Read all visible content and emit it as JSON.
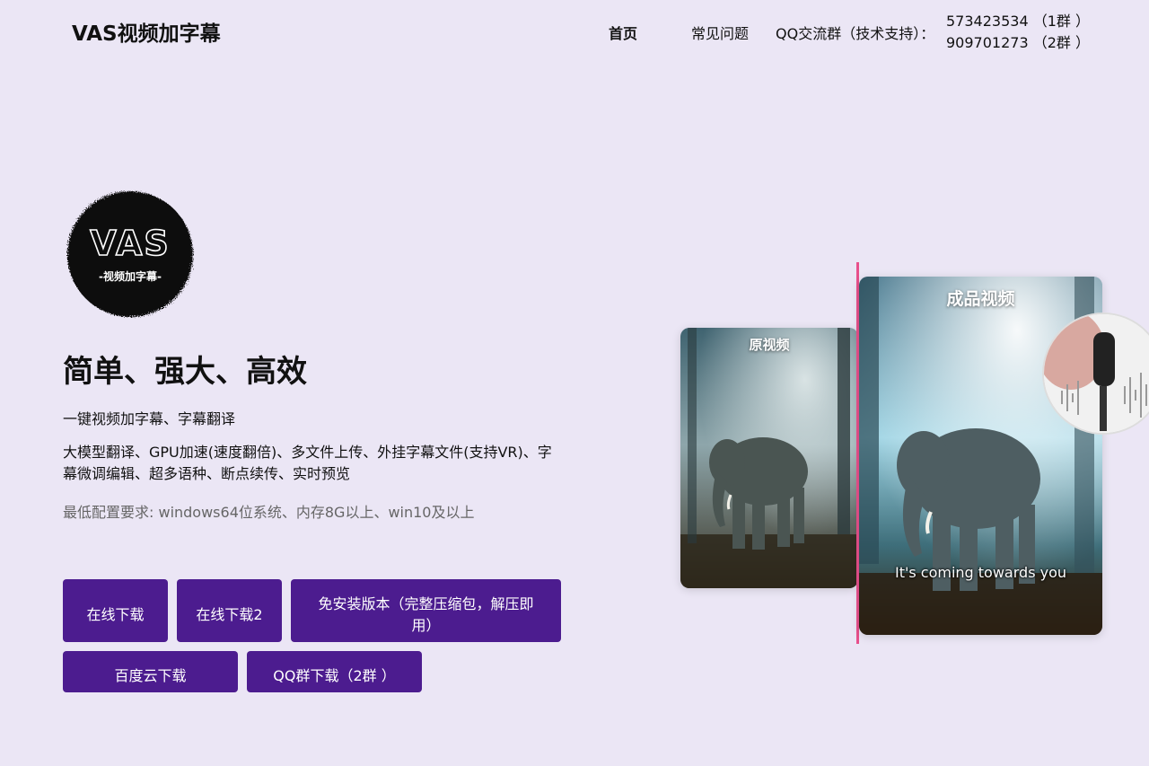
{
  "header": {
    "brand": "VAS视频加字幕",
    "nav": {
      "home": "首页",
      "faq": "常见问题"
    },
    "qq": {
      "label": "QQ交流群（技术支持）：",
      "groups": [
        "573423534 （1群 ）",
        "909701273 （2群 ）"
      ]
    }
  },
  "hero": {
    "logo": {
      "text": "VAS",
      "subtext": "-视频加字幕-"
    },
    "headline": "简单、强大、高效",
    "subtitle": "一键视频加字幕、字幕翻译",
    "features": "大模型翻译、GPU加速(速度翻倍)、多文件上传、外挂字幕文件(支持VR)、字幕微调编辑、超多语种、断点续传、实时预览",
    "requirements": "最低配置要求: windows64位系统、内存8G以上、win10及以上",
    "buttons": {
      "download_online": "在线下载",
      "download_online_2": "在线下载2",
      "portable": "免安装版本（完整压缩包，解压即用）",
      "baidu": "百度云下载",
      "qq_download": "QQ群下载（2群 ）"
    }
  },
  "illustration": {
    "original_label": "原视频",
    "final_label": "成品视频",
    "subtitle_line": "It's coming towards you"
  },
  "colors": {
    "background": "#ebe6f5",
    "button": "#4c1c8f",
    "divider": "#e8508c"
  }
}
